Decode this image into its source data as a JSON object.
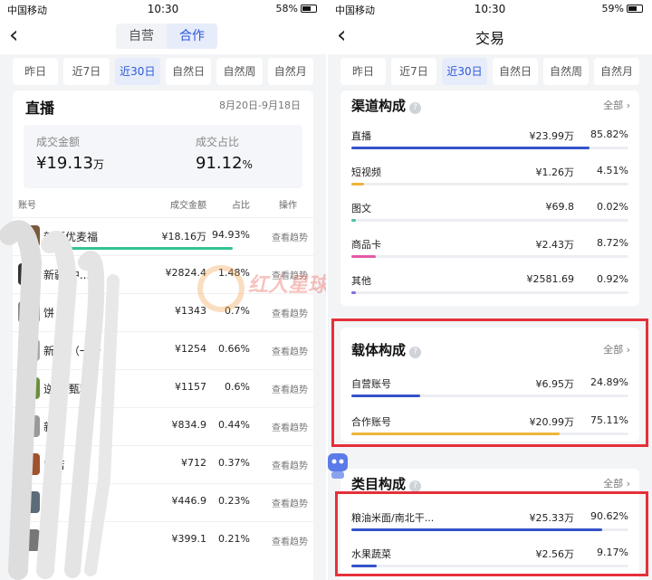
{
  "left": {
    "status": {
      "carrier": "中国移动",
      "time": "10:30",
      "battery": "58%"
    },
    "seg": [
      "自营",
      "合作"
    ],
    "seg_active": 1,
    "tabs": [
      "昨日",
      "近7日",
      "近30日",
      "自然日",
      "自然周",
      "自然月"
    ],
    "tab_active": 2,
    "section": {
      "title": "直播",
      "date_range": "8月20日-9月18日"
    },
    "summary": {
      "gmv_label": "成交金额",
      "gmv_value": "¥19.13",
      "gmv_unit": "万",
      "share_label": "成交占比",
      "share_value": "91.12",
      "share_unit": "%"
    },
    "table_headers": {
      "account": "账号",
      "amount": "成交金额",
      "share": "占比",
      "action": "操作"
    },
    "rows": [
      {
        "name": "新疆优麦福",
        "amount": "¥18.16万",
        "share": "94.93%",
        "action": "查看趋势",
        "bar": 0.9493
      },
      {
        "name": "新疆    中...",
        "amount": "¥2824.4",
        "share": "1.48%",
        "action": "查看趋势"
      },
      {
        "name": "饼",
        "amount": "¥1343",
        "share": "0.7%",
        "action": "查看趋势"
      },
      {
        "name": "新疆   （一个",
        "amount": "¥1254",
        "share": "0.66%",
        "action": "查看趋势"
      },
      {
        "name": "逆  （甄和",
        "amount": "¥1157",
        "share": "0.6%",
        "action": "查看趋势"
      },
      {
        "name": "新疆   ",
        "amount": "¥834.9",
        "share": "0.44%",
        "action": "查看趋势"
      },
      {
        "name": "   K    店",
        "amount": "¥712",
        "share": "0.37%",
        "action": "查看趋势"
      },
      {
        "name": "在",
        "amount": "¥446.9",
        "share": "0.23%",
        "action": "查看趋势"
      },
      {
        "name": "",
        "amount": "¥399.1",
        "share": "0.21%",
        "action": "查看趋势"
      }
    ],
    "watermark": "红人星球"
  },
  "right": {
    "status": {
      "carrier": "中国移动",
      "time": "10:30",
      "battery": "59%"
    },
    "title": "交易",
    "tabs": [
      "昨日",
      "近7日",
      "近30日",
      "自然日",
      "自然周",
      "自然月"
    ],
    "tab_active": 2,
    "all_label": "全部",
    "channel": {
      "title": "渠道构成",
      "items": [
        {
          "name": "直播",
          "amount": "¥23.99万",
          "pct": "85.82%",
          "ratio": 0.8582,
          "color": "#3552c9"
        },
        {
          "name": "短视频",
          "amount": "¥1.26万",
          "pct": "4.51%",
          "ratio": 0.0451,
          "color": "#f0b43c"
        },
        {
          "name": "图文",
          "amount": "¥69.8",
          "pct": "0.02%",
          "ratio": 0.0002,
          "color": "#4cc0a0"
        },
        {
          "name": "商品卡",
          "amount": "¥2.43万",
          "pct": "8.72%",
          "ratio": 0.0872,
          "color": "#e45aa8"
        },
        {
          "name": "其他",
          "amount": "¥2581.69",
          "pct": "0.92%",
          "ratio": 0.0092,
          "color": "#7a6ee0"
        }
      ]
    },
    "carrier_comp": {
      "title": "载体构成",
      "items": [
        {
          "name": "自营账号",
          "amount": "¥6.95万",
          "pct": "24.89%",
          "ratio": 0.2489,
          "color": "#3552c9"
        },
        {
          "name": "合作账号",
          "amount": "¥20.99万",
          "pct": "75.11%",
          "ratio": 0.7511,
          "color": "#f0b43c"
        }
      ]
    },
    "category": {
      "title": "类目构成",
      "items": [
        {
          "name": "粮油米面/南北干...",
          "amount": "¥25.33万",
          "pct": "90.62%",
          "ratio": 0.9062,
          "color": "#3552c9"
        },
        {
          "name": "水果蔬菜",
          "amount": "¥2.56万",
          "pct": "9.17%",
          "ratio": 0.0917,
          "color": "#3552c9"
        }
      ]
    }
  },
  "colors": {
    "accent": "#2b59d9",
    "highlight_box": "#e5303a",
    "live_bar": "#34c38f"
  }
}
